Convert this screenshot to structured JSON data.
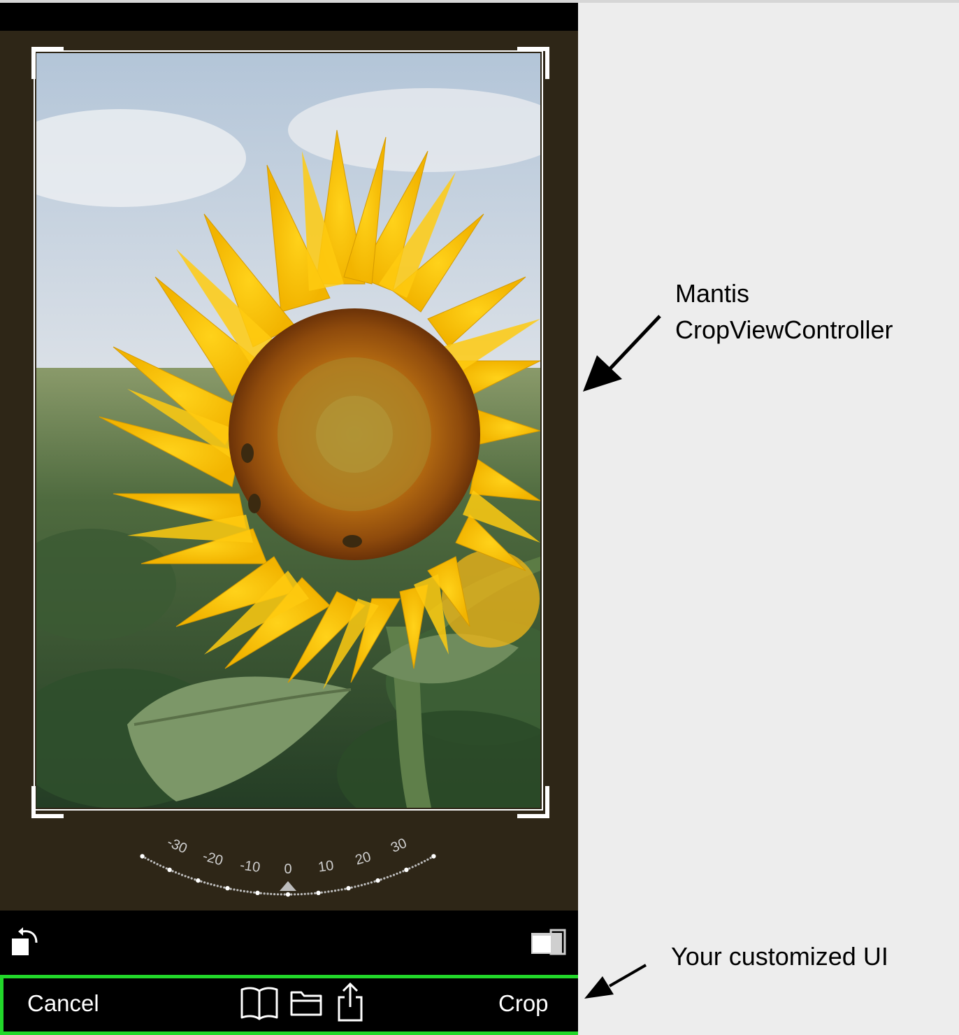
{
  "annotations": {
    "mantis_line1": "Mantis",
    "mantis_line2": "CropViewController",
    "custom_ui": "Your customized UI"
  },
  "dial": {
    "ticks": [
      "-30",
      "-20",
      "-10",
      "0",
      "10",
      "20",
      "30"
    ]
  },
  "toolbar": {
    "rotate_icon": "rotate-left-icon",
    "ratio_icon": "aspect-ratio-icon"
  },
  "custom_bar": {
    "cancel_label": "Cancel",
    "crop_label": "Crop",
    "icons": [
      "book-icon",
      "folder-icon",
      "share-icon"
    ],
    "border_color": "#22d82a"
  },
  "colors": {
    "crop_background": "#2e2617",
    "accent_green": "#22d82a"
  }
}
